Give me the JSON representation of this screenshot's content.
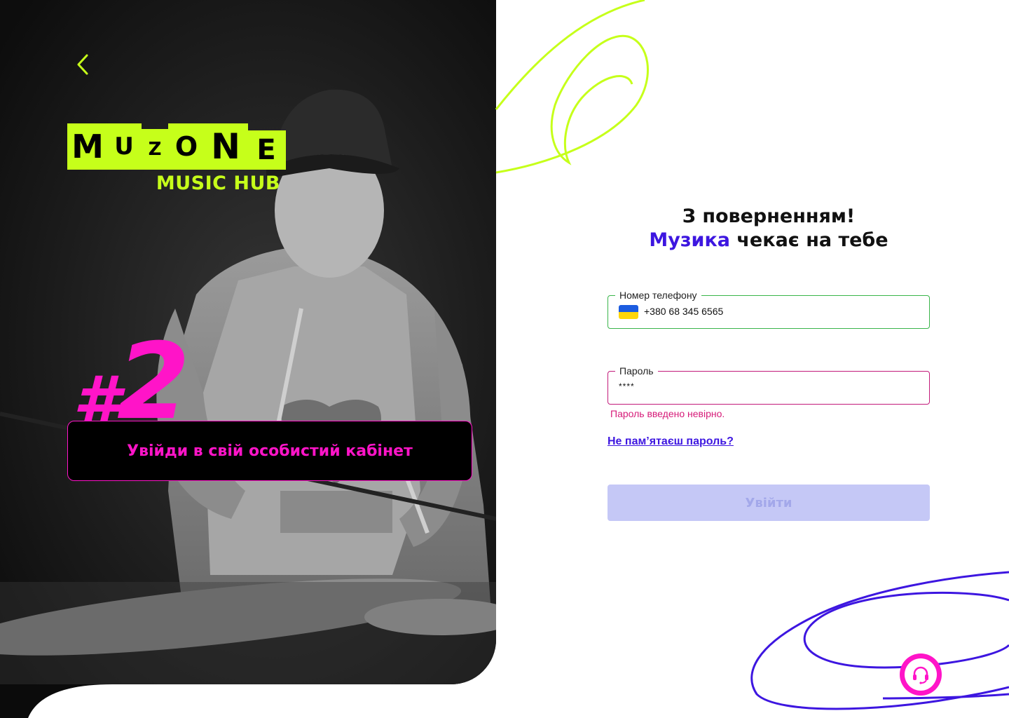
{
  "brand": {
    "logo_text": "MUZONE",
    "logo_letters": [
      "M",
      "U",
      "Z",
      "O",
      "N",
      "E"
    ],
    "subtitle": "MUSIC HUB"
  },
  "promo": {
    "rank_hash": "#",
    "rank_number": "2",
    "cta": "Увійди в свій особистий кабінет"
  },
  "login": {
    "greeting_line1": "З поверненням!",
    "greeting_accent": "Музика",
    "greeting_rest": " чекає на тебе",
    "phone": {
      "label": "Номер телефону",
      "value": "+380 68 345 6565",
      "flag": "ukraine-flag-icon"
    },
    "password": {
      "label": "Пароль",
      "value": "****",
      "error": "Пароль введено невірно."
    },
    "forgot_link": "Не пам’ятаєш пароль?",
    "submit_label": "Увійти"
  },
  "icons": {
    "back": "chevron-left-icon",
    "support": "headset-icon"
  },
  "colors": {
    "lime": "#c6ff1a",
    "magenta": "#ff14c8",
    "accent_blue": "#3d16e0",
    "phone_border_ok": "#3ab54a",
    "password_border_error": "#c21a7a",
    "button_disabled_bg": "#c5c8f6"
  }
}
